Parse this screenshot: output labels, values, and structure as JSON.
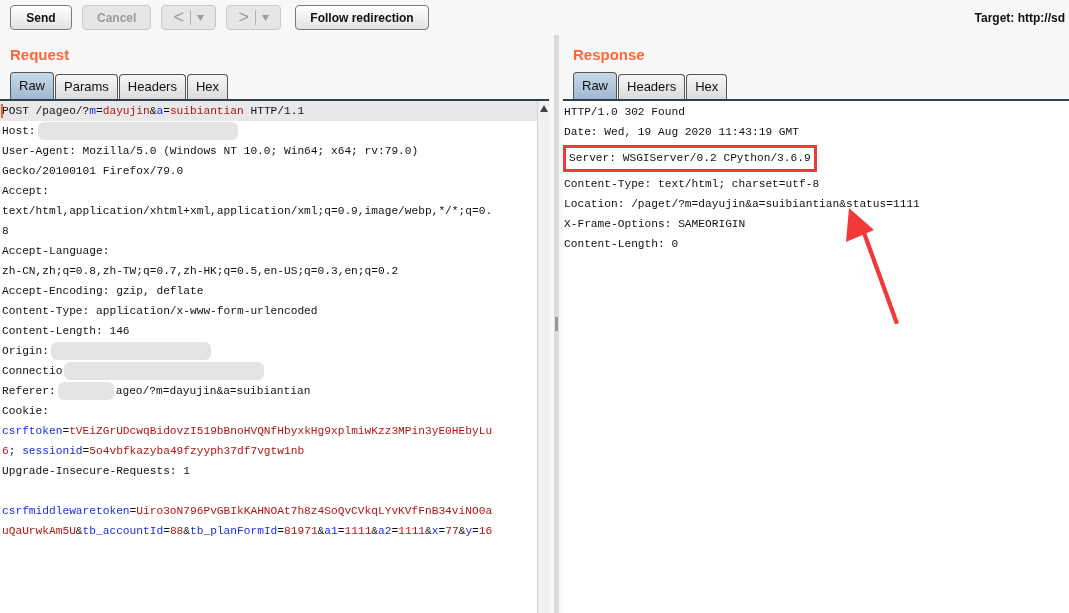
{
  "toolbar": {
    "buttons": [
      {
        "kind": "text",
        "label": "Send",
        "disabled": false
      },
      {
        "kind": "text",
        "label": "Cancel",
        "disabled": true
      },
      {
        "kind": "nav",
        "label": "<",
        "disabled": true
      },
      {
        "kind": "nav",
        "label": ">",
        "disabled": true
      },
      {
        "kind": "text",
        "label": "Follow redirection",
        "disabled": false
      }
    ],
    "target": "Target: http://sd"
  },
  "request": {
    "title": "Request",
    "tabs": [
      {
        "label": "Raw",
        "selected": true
      },
      {
        "label": "Params",
        "selected": false
      },
      {
        "label": "Headers",
        "selected": false
      },
      {
        "label": "Hex",
        "selected": false
      }
    ],
    "lines": [
      {
        "kind": "text",
        "current": true,
        "segments": [
          {
            "kind": "plain",
            "text": "POST /pageo/?"
          },
          {
            "kind": "name",
            "text": "m"
          },
          {
            "kind": "plain",
            "text": "="
          },
          {
            "kind": "value",
            "text": "dayujin"
          },
          {
            "kind": "plain",
            "text": "&"
          },
          {
            "kind": "name",
            "text": "a"
          },
          {
            "kind": "plain",
            "text": "="
          },
          {
            "kind": "value",
            "text": "suibiantian"
          },
          {
            "kind": "plain",
            "text": " HTTP/1.1"
          }
        ]
      },
      {
        "kind": "text",
        "current": false,
        "segments": [
          {
            "kind": "plain",
            "text": "Host:"
          },
          {
            "kind": "redacted"
          }
        ]
      },
      {
        "kind": "text",
        "current": false,
        "segments": [
          {
            "kind": "plain",
            "text": "User-Agent: Mozilla/5.0 (Windows NT 10.0; Win64; x64; rv:79.0)"
          }
        ]
      },
      {
        "kind": "text",
        "current": false,
        "segments": [
          {
            "kind": "plain",
            "text": "Gecko/20100101 Firefox/79.0"
          }
        ]
      },
      {
        "kind": "text",
        "current": false,
        "segments": [
          {
            "kind": "plain",
            "text": "Accept:"
          }
        ]
      },
      {
        "kind": "text",
        "current": false,
        "segments": [
          {
            "kind": "plain",
            "text": "text/html,application/xhtml+xml,application/xml;q=0.9,image/webp,*/*;q=0."
          }
        ]
      },
      {
        "kind": "text",
        "current": false,
        "segments": [
          {
            "kind": "plain",
            "text": "8"
          }
        ]
      },
      {
        "kind": "text",
        "current": false,
        "segments": [
          {
            "kind": "plain",
            "text": "Accept-Language:"
          }
        ]
      },
      {
        "kind": "text",
        "current": false,
        "segments": [
          {
            "kind": "plain",
            "text": "zh-CN,zh;q=0.8,zh-TW;q=0.7,zh-HK;q=0.5,en-US;q=0.3,en;q=0.2"
          }
        ]
      },
      {
        "kind": "text",
        "current": false,
        "segments": [
          {
            "kind": "plain",
            "text": "Accept-Encoding: gzip, deflate"
          }
        ]
      },
      {
        "kind": "text",
        "current": false,
        "segments": [
          {
            "kind": "plain",
            "text": "Content-Type: application/x-www-form-urlencoded"
          }
        ]
      },
      {
        "kind": "text",
        "current": false,
        "segments": [
          {
            "kind": "plain",
            "text": "Content-Length: 146"
          }
        ]
      },
      {
        "kind": "text",
        "current": false,
        "segments": [
          {
            "kind": "plain",
            "text": "Origin:"
          },
          {
            "kind": "redacted"
          }
        ]
      },
      {
        "kind": "text",
        "current": false,
        "segments": [
          {
            "kind": "plain",
            "text": "Connectio"
          },
          {
            "kind": "redacted"
          }
        ]
      },
      {
        "kind": "text",
        "current": false,
        "segments": [
          {
            "kind": "plain",
            "text": "Referer:"
          },
          {
            "kind": "redacted"
          },
          {
            "kind": "plain",
            "text": "ageo/?m=dayujin&a=suibiantian"
          }
        ]
      },
      {
        "kind": "text",
        "current": false,
        "segments": [
          {
            "kind": "plain",
            "text": "Cookie:"
          }
        ]
      },
      {
        "kind": "text",
        "current": false,
        "segments": [
          {
            "kind": "name",
            "text": "csrftoken"
          },
          {
            "kind": "plain",
            "text": "="
          },
          {
            "kind": "value",
            "text": "tVEiZGrUDcwqBidovzI519bBnoHVQNfHbyxkHg9xplmiwKzz3MPin3yE0HEbyLu"
          }
        ]
      },
      {
        "kind": "text",
        "current": false,
        "segments": [
          {
            "kind": "value",
            "text": "6"
          },
          {
            "kind": "plain",
            "text": "; "
          },
          {
            "kind": "name",
            "text": "sessionid"
          },
          {
            "kind": "plain",
            "text": "="
          },
          {
            "kind": "value",
            "text": "5o4vbfkazyba49fzyyph37df7vgtw1nb"
          }
        ]
      },
      {
        "kind": "text",
        "current": false,
        "segments": [
          {
            "kind": "plain",
            "text": "Upgrade-Insecure-Requests: 1"
          }
        ]
      },
      {
        "kind": "blank",
        "current": false
      },
      {
        "kind": "text",
        "current": false,
        "segments": [
          {
            "kind": "name",
            "text": "csrfmiddlewaretoken"
          },
          {
            "kind": "plain",
            "text": "="
          },
          {
            "kind": "value",
            "text": "Uiro3oN796PvGBIkKAHNOAt7h8z4SoQvCVkqLYvKVfFnB34viNO0a"
          }
        ]
      },
      {
        "kind": "text",
        "current": false,
        "segments": [
          {
            "kind": "value",
            "text": "uQaUrwkAm5U"
          },
          {
            "kind": "plain",
            "text": "&"
          },
          {
            "kind": "name",
            "text": "tb_accountId"
          },
          {
            "kind": "plain",
            "text": "="
          },
          {
            "kind": "value",
            "text": "88"
          },
          {
            "kind": "plain",
            "text": "&"
          },
          {
            "kind": "name",
            "text": "tb_planFormId"
          },
          {
            "kind": "plain",
            "text": "="
          },
          {
            "kind": "value",
            "text": "81971"
          },
          {
            "kind": "plain",
            "text": "&"
          },
          {
            "kind": "name",
            "text": "a1"
          },
          {
            "kind": "plain",
            "text": "="
          },
          {
            "kind": "value",
            "text": "1111"
          },
          {
            "kind": "plain",
            "text": "&"
          },
          {
            "kind": "name",
            "text": "a2"
          },
          {
            "kind": "plain",
            "text": "="
          },
          {
            "kind": "value",
            "text": "1111"
          },
          {
            "kind": "plain",
            "text": "&"
          },
          {
            "kind": "name",
            "text": "x"
          },
          {
            "kind": "plain",
            "text": "="
          },
          {
            "kind": "value",
            "text": "77"
          },
          {
            "kind": "plain",
            "text": "&"
          },
          {
            "kind": "name",
            "text": "y"
          },
          {
            "kind": "plain",
            "text": "="
          },
          {
            "kind": "value",
            "text": "16"
          }
        ]
      }
    ]
  },
  "response": {
    "title": "Response",
    "tabs": [
      {
        "label": "Raw",
        "selected": true
      },
      {
        "label": "Headers",
        "selected": false
      },
      {
        "label": "Hex",
        "selected": false
      }
    ],
    "lines": [
      {
        "text": "HTTP/1.0 302 Found",
        "annotated": false
      },
      {
        "text": "Date: Wed, 19 Aug 2020 11:43:19 GMT",
        "annotated": false
      },
      {
        "text": "Server: WSGIServer/0.2 CPython/3.6.9",
        "annotated": true
      },
      {
        "text": "Content-Type: text/html; charset=utf-8",
        "annotated": false
      },
      {
        "text": "Location: /paget/?m=dayujin&a=suibiantian&status=1111",
        "annotated": false
      },
      {
        "text": "X-Frame-Options: SAMEORIGIN",
        "annotated": false
      },
      {
        "text": "Content-Length: 0",
        "annotated": false
      }
    ]
  }
}
